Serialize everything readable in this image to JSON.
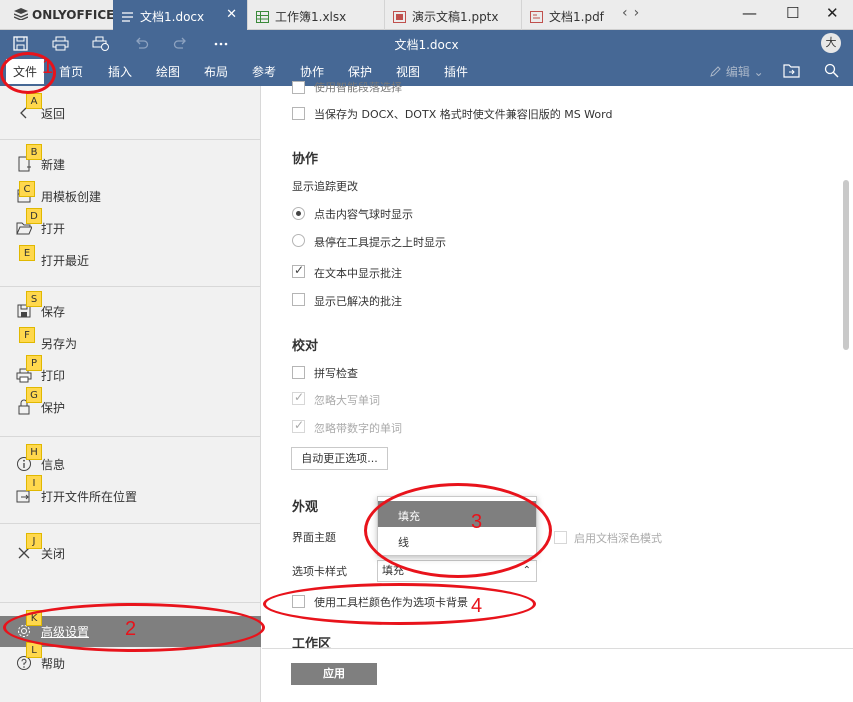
{
  "brand": "ONLYOFFICE",
  "tabs": [
    {
      "label": "文档1.docx",
      "icon": "document-icon",
      "active": true,
      "close": "✕"
    },
    {
      "label": "工作簿1.xlsx",
      "icon": "spreadsheet-icon",
      "active": false
    },
    {
      "label": "演示文稿1.pptx",
      "icon": "presentation-icon",
      "active": false
    },
    {
      "label": "文档1.pdf",
      "icon": "pdf-icon",
      "active": false
    }
  ],
  "nav": {
    "prev": "‹",
    "next": "›"
  },
  "window_controls": {
    "minimize": "—",
    "maximize": "☐",
    "close": "✕"
  },
  "header": {
    "doc_title": "文档1.docx",
    "avatar": "大",
    "menu": [
      "文件",
      "首页",
      "插入",
      "绘图",
      "布局",
      "参考",
      "协作",
      "保护",
      "视图",
      "插件"
    ],
    "edit_mode": "编辑"
  },
  "left_menu": {
    "items": [
      {
        "key": "A",
        "label": "返回",
        "icon": "back-icon"
      },
      {
        "key": "B",
        "label": "新建",
        "icon": "new-doc-icon"
      },
      {
        "key": "C",
        "label": "用模板创建",
        "icon": "template-icon"
      },
      {
        "key": "D",
        "label": "打开",
        "icon": "open-folder-icon"
      },
      {
        "key": "E",
        "label": "打开最近",
        "icon": "recent-icon"
      },
      {
        "key": "S",
        "label": "保存",
        "icon": "save-icon"
      },
      {
        "key": "F",
        "label": "另存为",
        "icon": "save-as-icon"
      },
      {
        "key": "P",
        "label": "打印",
        "icon": "print-icon"
      },
      {
        "key": "G",
        "label": "保护",
        "icon": "lock-icon"
      },
      {
        "key": "H",
        "label": "信息",
        "icon": "info-icon"
      },
      {
        "key": "I",
        "label": "打开文件所在位置",
        "icon": "open-location-icon"
      },
      {
        "key": "J",
        "label": "关闭",
        "icon": "close-icon"
      },
      {
        "key": "K",
        "label": "高级设置",
        "icon": "gear-icon"
      },
      {
        "key": "L",
        "label": "帮助",
        "icon": "help-icon"
      }
    ]
  },
  "settings": {
    "top_partial": "使用智能段落选择",
    "compat": "当保存为 DOCX、DOTX 格式时使文件兼容旧版的 MS Word",
    "collab": {
      "title": "协作",
      "track_title": "显示追踪更改",
      "radio1": "点击内容气球时显示",
      "radio2": "悬停在工具提示之上时显示",
      "show_comments": "在文本中显示批注",
      "show_resolved": "显示已解决的批注"
    },
    "proofing": {
      "title": "校对",
      "spell": "拼写检查",
      "ignore_upper": "忽略大写单词",
      "ignore_numbers": "忽略带数字的单词",
      "autocorrect": "自动更正选项..."
    },
    "appearance": {
      "title": "外观",
      "theme_label": "界面主题",
      "dark_mode": "启用文档深色模式",
      "tab_style_label": "选项卡样式",
      "tab_style_value": "填充",
      "dropdown_options": [
        "填充",
        "线"
      ],
      "toolbar_color_bg": "使用工具栏颜色作为选项卡背景"
    },
    "workspace_title": "工作区",
    "apply": "应用"
  },
  "annotations": [
    "1",
    "2",
    "3",
    "4"
  ],
  "colors": {
    "header_blue": "#466895",
    "annotation_red": "#e8131b",
    "keytip_yellow": "#ffd84d",
    "selection_gray": "#7f7f7f"
  }
}
